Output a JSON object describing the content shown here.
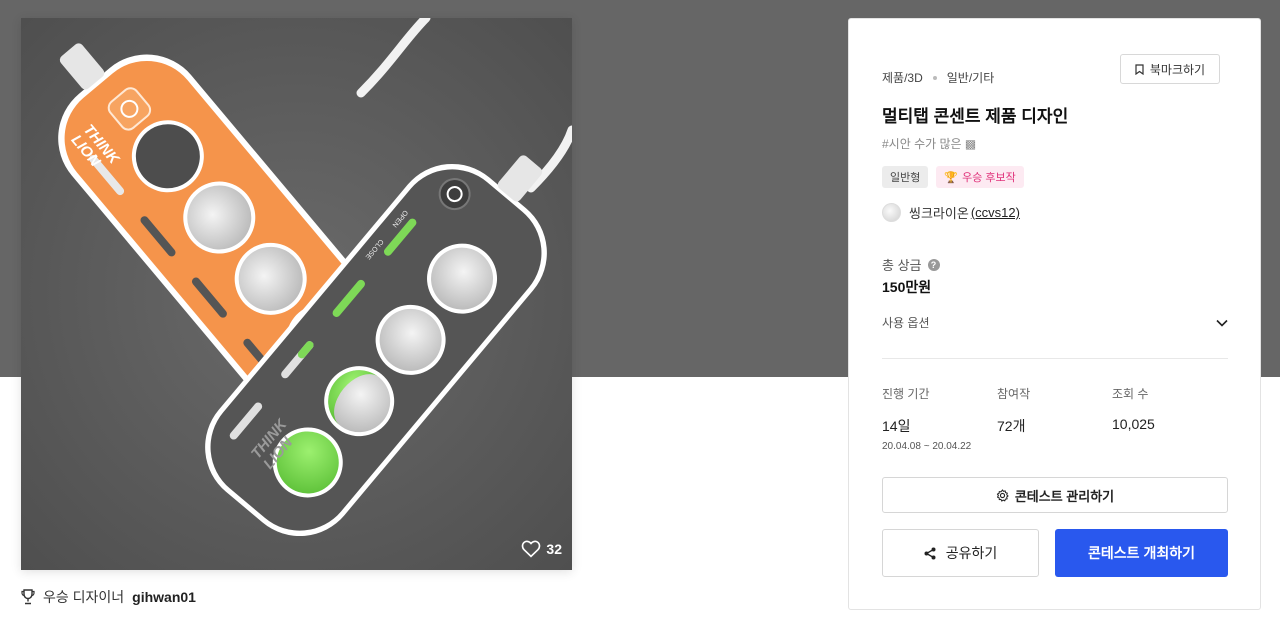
{
  "hero": {
    "likes": "32",
    "product_left": {
      "brand_line1": "THINK",
      "brand_line2": "LION"
    },
    "product_right": {
      "brand_line1": "THINK",
      "brand_line2": "LION",
      "open_label": "OPEN",
      "close_label": "CLOSE"
    }
  },
  "winner": {
    "label": "우승 디자이너",
    "username": "gihwan01"
  },
  "card": {
    "crumb_category": "제품/3D",
    "crumb_subcategory": "일반/기타",
    "bookmark_label": "북마크하기",
    "title": "멀티탭 콘센트 제품 디자인",
    "hashtag": "#시안 수가 많은 ▩",
    "badge_type": "일반형",
    "badge_award": "우승 후보작",
    "organizer_name": "씽크라이온",
    "organizer_handle": "(ccvs12)",
    "prize_label": "총 상금",
    "prize_help": "?",
    "prize_value": "150만원",
    "usage_label": "사용 옵션",
    "stats": {
      "period_label": "진행 기간",
      "period_value": "14일",
      "period_dates": "20.04.08 ~ 20.04.22",
      "entries_label": "참여작",
      "entries_value": "72개",
      "views_label": "조회 수",
      "views_value": "10,025"
    },
    "manage_label": "콘테스트 관리하기",
    "share_label": "공유하기",
    "host_label": "콘테스트 개최하기"
  },
  "colors": {
    "accent_blue": "#2958ee",
    "award_pink": "#e0317a",
    "product_orange": "#f5944b",
    "indicator_green": "#7ed957"
  }
}
